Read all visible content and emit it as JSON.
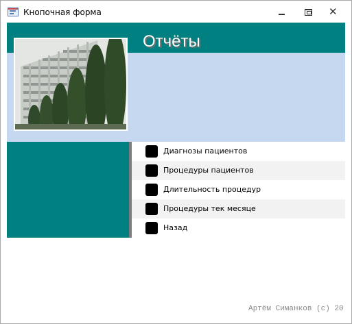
{
  "window": {
    "title": "Кнопочная форма",
    "icon": "form-icon",
    "controls": {
      "minimize_icon": "minimize-icon",
      "maximize_icon": "maximize-icon",
      "close_icon": "close-icon",
      "close_glyph": "✕"
    }
  },
  "form": {
    "heading": "Отчёты",
    "photo": "building-photo",
    "menu_items": [
      {
        "label": "Диагнозы пациентов"
      },
      {
        "label": "Процедуры пациентов"
      },
      {
        "label": "Длительность процедур"
      },
      {
        "label": "Процедуры тек месяце"
      },
      {
        "label": "Назад"
      }
    ],
    "footer_credit": "Артём Симанков (с) 20"
  },
  "colors": {
    "header_teal": "#008080",
    "light_blue": "#c5d8f0",
    "menu_alt_row": "#f2f2f2",
    "menu_button": "#000000"
  }
}
